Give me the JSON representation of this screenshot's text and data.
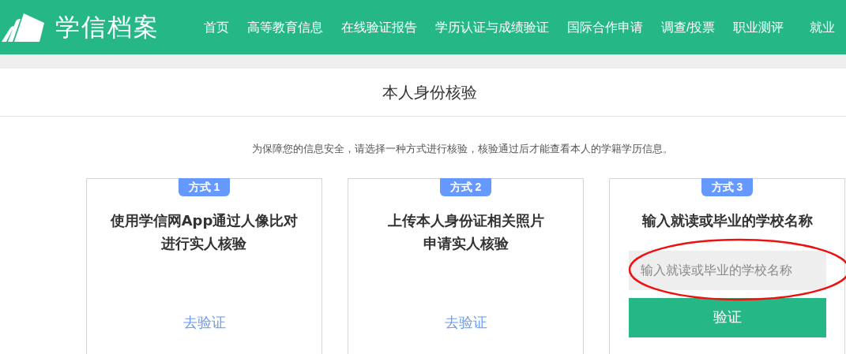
{
  "header": {
    "logo_text": "学信档案",
    "nav": [
      "首页",
      "高等教育信息",
      "在线验证报告",
      "学历认证与成绩验证",
      "国际合作申请",
      "调查/投票",
      "职业测评",
      "就业"
    ]
  },
  "page_title": "本人身份核验",
  "notice": "为保障您的信息安全，请选择一种方式进行核验，核验通过后才能查看本人的学籍学历信息。",
  "methods": [
    {
      "kind": "link",
      "badge": "方式 1",
      "title_lines": [
        "使用学信网App通过人像比对",
        "进行实人核验"
      ],
      "link": "去验证"
    },
    {
      "kind": "link",
      "badge": "方式 2",
      "title_lines": [
        "上传本人身份证相关照片",
        "申请实人核验"
      ],
      "link": "去验证"
    },
    {
      "kind": "form",
      "badge": "方式 3",
      "title_lines": [
        "输入就读或毕业的学校名称"
      ],
      "placeholder": "输入就读或毕业的学校名称",
      "button": "验证",
      "highlighted": true
    }
  ]
}
